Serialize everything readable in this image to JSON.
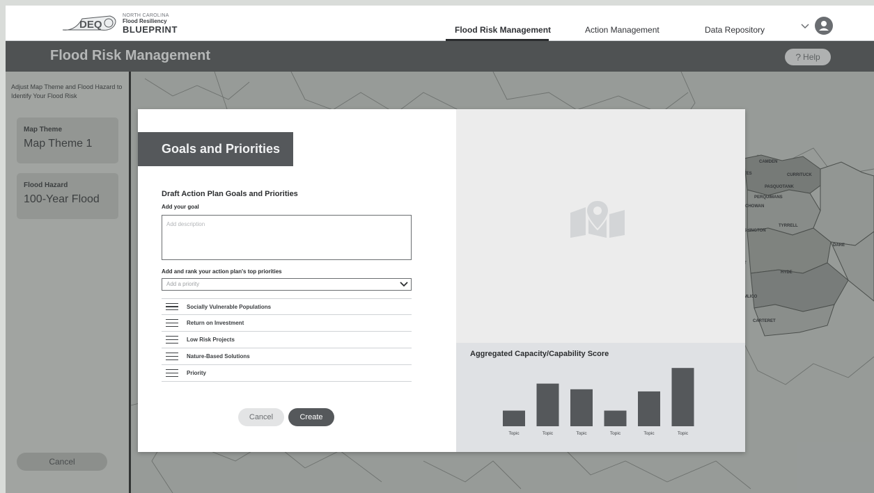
{
  "header": {
    "logo": {
      "badge": "DEQ",
      "line1": "NORTH CAROLINA",
      "line2": "Flood Resiliency",
      "line3": "BLUEPRINT"
    },
    "nav": [
      {
        "label": "Flood Risk Management",
        "active": true
      },
      {
        "label": "Action Management",
        "active": false
      },
      {
        "label": "Data Repository",
        "active": false
      }
    ]
  },
  "titlebar": {
    "title": "Flood Risk Management",
    "help_label": "Help",
    "help_icon": "?"
  },
  "sidebar": {
    "intro": "Adjust Map Theme and Flood Hazard to Identify Your Flood Risk",
    "map_theme_label": "Map Theme",
    "map_theme_value": "Map Theme 1",
    "flood_hazard_label": "Flood Hazard",
    "flood_hazard_value": "100-Year Flood",
    "cancel_label": "Cancel"
  },
  "map_labels": [
    "CAMDEN",
    "TES",
    "CURRITUCK",
    "PASQUOTANK",
    "PERQUIMANS",
    "CHOWAN",
    "SHINGTON",
    "TYRRELL",
    "DARE",
    "HYDE",
    "MLICO",
    "CARTERET",
    "T"
  ],
  "modal": {
    "header": "Goals and Priorities",
    "section_title": "Draft Action Plan Goals and Priorities",
    "goal_label": "Add your goal",
    "goal_placeholder": "Add description",
    "priorities_label": "Add and rank your action plan's top priorities",
    "priority_placeholder": "Add a priority",
    "priorities": [
      "Socially Vulnerable Populations",
      "Return on Investment",
      "Low Risk Projects",
      "Nature-Based Solutions",
      "Priority"
    ],
    "cancel_label": "Cancel",
    "create_label": "Create"
  },
  "chart_data": {
    "type": "bar",
    "title": "Aggregated Capacity/Capability Score",
    "categories": [
      "Topic",
      "Topic",
      "Topic",
      "Topic",
      "Topic",
      "Topic"
    ],
    "values": [
      2.2,
      6.0,
      5.2,
      2.2,
      4.9,
      8.2
    ],
    "ylim": [
      0,
      9
    ],
    "xlabel": "",
    "ylabel": "",
    "grid": false,
    "color": "#55585b"
  },
  "colors": {
    "dark_gray": "#55585b",
    "map_bg": "#b9bdba",
    "modal_right_bg": "#ececec",
    "chart_bg": "#dfe1e4"
  }
}
